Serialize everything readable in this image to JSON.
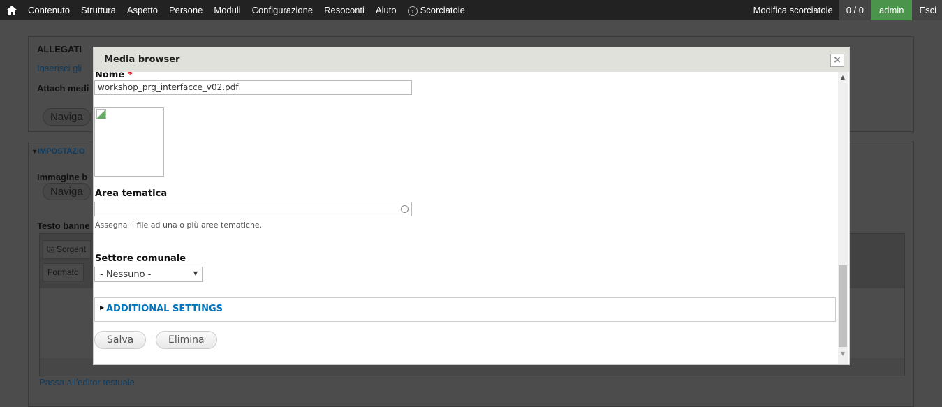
{
  "toolbar": {
    "home_icon": "home-icon",
    "items": [
      "Contenuto",
      "Struttura",
      "Aspetto",
      "Persone",
      "Moduli",
      "Configurazione",
      "Resoconti",
      "Aiuto"
    ],
    "shortcuts": "Scorciatoie",
    "edit_shortcuts": "Modifica scorciatoie",
    "count": "0 / 0",
    "user": "admin",
    "logout": "Esci"
  },
  "background": {
    "allegati": "ALLEGATI",
    "inserisci": "Inserisci gli",
    "attach": "Attach medi",
    "naviga1": "Naviga",
    "impostazioni": "IMPOSTAZIO",
    "immagine": "Immagine b",
    "naviga2": "Naviga",
    "testo": "Testo banne",
    "sorgente": "Sorgent",
    "formato": "Formato",
    "passa": "Passa all'editor testuale"
  },
  "modal": {
    "title": "Media browser",
    "close": "×",
    "nome_label": "Nome",
    "nome_required": "*",
    "nome_value": "workshop_prg_interfacce_v02.pdf",
    "area_label": "Area tematica",
    "area_value": "",
    "area_help": "Assegna il file ad una o più aree tematiche.",
    "settore_label": "Settore comunale",
    "settore_value": "- Nessuno -",
    "additional": "ADDITIONAL SETTINGS",
    "save": "Salva",
    "delete": "Elimina"
  },
  "colors": {
    "toolbar": "#222222",
    "admin": "#4b944b",
    "link": "#0074bd",
    "modal_header": "#e1e1dc"
  }
}
